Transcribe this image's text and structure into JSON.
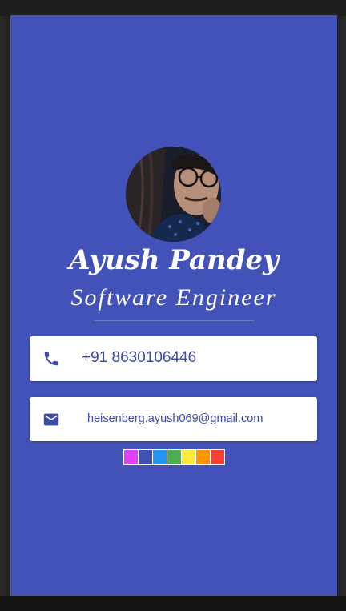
{
  "profile": {
    "name": "Ayush Pandey",
    "title": "Software Engineer"
  },
  "contact": {
    "phone": "+91 8630106446",
    "phone_icon": "phone-icon",
    "email": "heisenberg.ayush069@gmail.com",
    "email_icon": "email-icon"
  },
  "colors": {
    "background": "#4252b8",
    "card": "#ffffff",
    "accent_text": "#3a4aa8"
  },
  "theme_swatches": [
    "#e040fb",
    "#3f51b5",
    "#2196f3",
    "#4caf50",
    "#ffeb3b",
    "#ff9800",
    "#f44336"
  ]
}
